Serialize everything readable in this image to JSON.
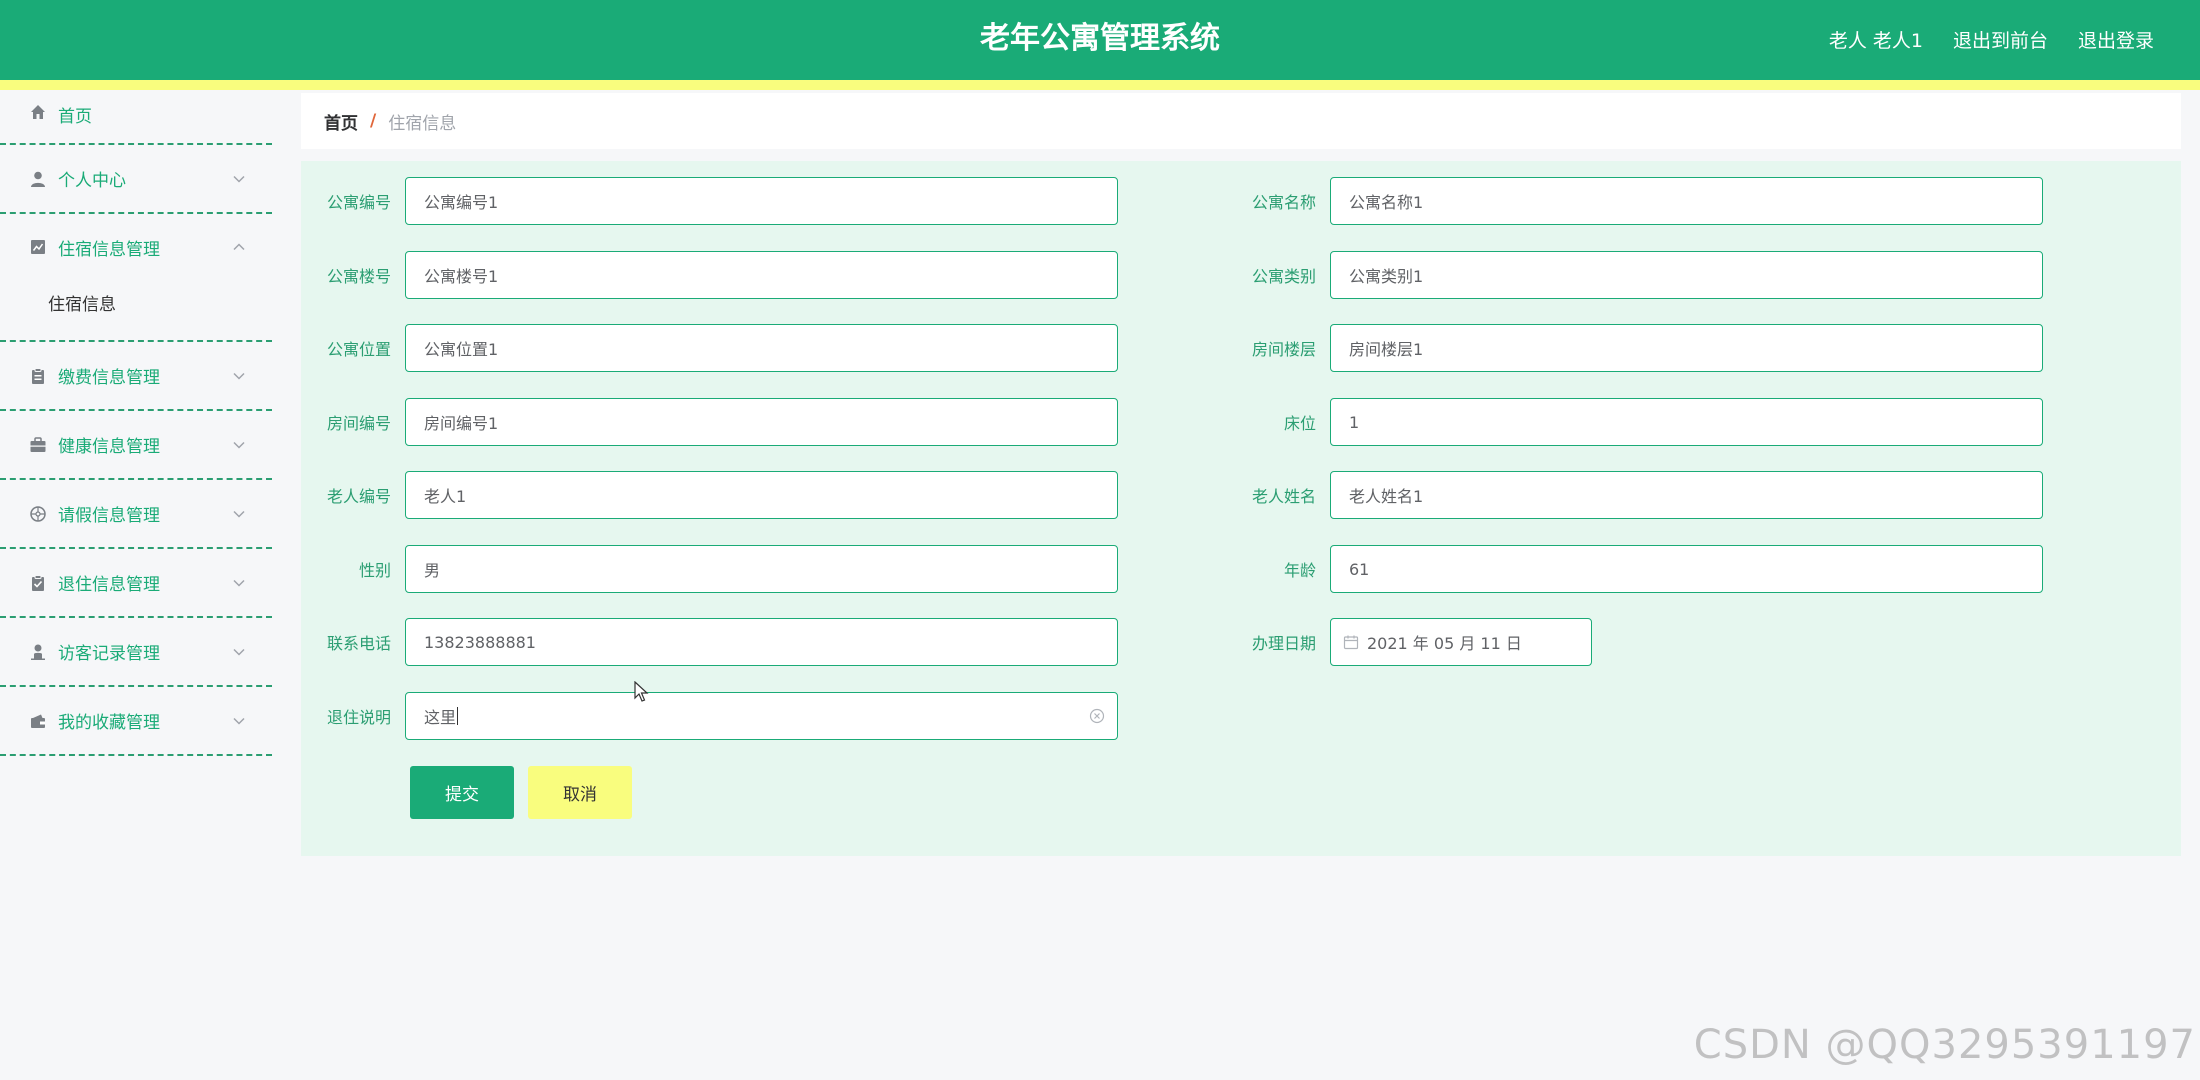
{
  "header": {
    "title": "老年公寓管理系统",
    "user_label": "老人 老人1",
    "to_frontend": "退出到前台",
    "logout": "退出登录"
  },
  "sidebar": {
    "items": [
      {
        "label": "首页",
        "icon": "home-icon"
      },
      {
        "label": "个人中心",
        "icon": "person-icon"
      },
      {
        "label": "住宿信息管理",
        "icon": "chart-icon",
        "expanded": true,
        "children": [
          {
            "label": "住宿信息"
          }
        ]
      },
      {
        "label": "缴费信息管理",
        "icon": "clipboard-icon"
      },
      {
        "label": "健康信息管理",
        "icon": "briefcase-icon"
      },
      {
        "label": "请假信息管理",
        "icon": "compass-icon"
      },
      {
        "label": "退住信息管理",
        "icon": "checklist-icon"
      },
      {
        "label": "访客记录管理",
        "icon": "visitor-icon"
      },
      {
        "label": "我的收藏管理",
        "icon": "wallet-icon"
      }
    ]
  },
  "breadcrumb": {
    "home": "首页",
    "separator": "/",
    "current": "住宿信息"
  },
  "form": {
    "apartment_no": {
      "label": "公寓编号",
      "value": "公寓编号1"
    },
    "apartment_name": {
      "label": "公寓名称",
      "value": "公寓名称1"
    },
    "building_no": {
      "label": "公寓楼号",
      "value": "公寓楼号1"
    },
    "apartment_type": {
      "label": "公寓类别",
      "value": "公寓类别1"
    },
    "location": {
      "label": "公寓位置",
      "value": "公寓位置1"
    },
    "floor": {
      "label": "房间楼层",
      "value": "房间楼层1"
    },
    "room_no": {
      "label": "房间编号",
      "value": "房间编号1"
    },
    "bed": {
      "label": "床位",
      "value": "1"
    },
    "elder_no": {
      "label": "老人编号",
      "value": "老人1"
    },
    "elder_name": {
      "label": "老人姓名",
      "value": "老人姓名1"
    },
    "gender": {
      "label": "性别",
      "value": "男"
    },
    "age": {
      "label": "年龄",
      "value": "61"
    },
    "phone": {
      "label": "联系电话",
      "value": "13823888881"
    },
    "date": {
      "label": "办理日期",
      "value": "2021 年 05 月 11 日"
    },
    "checkout_note": {
      "label": "退住说明",
      "value": "这里"
    },
    "submit": "提交",
    "cancel": "取消"
  },
  "watermark": "CSDN @QQ3295391197",
  "colors": {
    "primary": "#1aab77",
    "accent_yellow": "#f9fd7e",
    "panel_bg": "#e6f7ef"
  }
}
